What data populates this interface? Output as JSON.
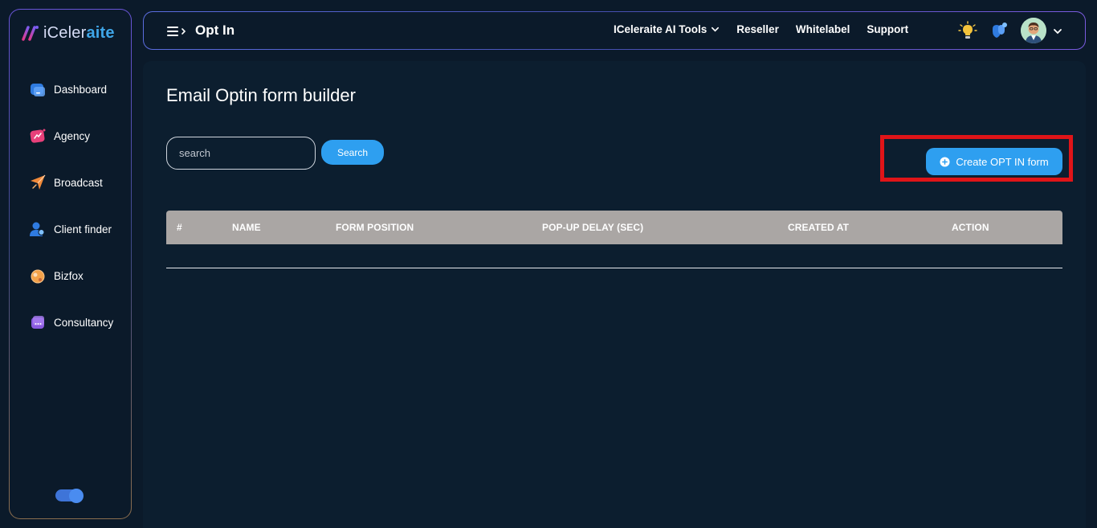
{
  "sidebar": {
    "logo": {
      "part1": "iCeler",
      "part2": "aite"
    },
    "items": [
      {
        "label": "Dashboard",
        "icon": "dashboard-icon"
      },
      {
        "label": "Agency",
        "icon": "agency-icon"
      },
      {
        "label": "Broadcast",
        "icon": "broadcast-icon"
      },
      {
        "label": "Client finder",
        "icon": "client-finder-icon"
      },
      {
        "label": "Bizfox",
        "icon": "bizfox-icon"
      },
      {
        "label": "Consultancy",
        "icon": "consultancy-icon"
      }
    ],
    "theme_toggle_on": true
  },
  "header": {
    "title": "Opt In",
    "links": [
      {
        "label": "ICeleraite AI Tools",
        "has_dropdown": true
      },
      {
        "label": "Reseller"
      },
      {
        "label": "Whitelabel"
      },
      {
        "label": "Support"
      }
    ],
    "icons": [
      "lightbulb-icon",
      "notifications-icon",
      "avatar",
      "chevron-down-icon"
    ]
  },
  "main": {
    "heading": "Email Optin form builder",
    "search": {
      "placeholder": "search",
      "value": "",
      "button_label": "Search"
    },
    "create_button_label": "Create OPT IN form",
    "table": {
      "columns": [
        "#",
        "NAME",
        "FORM POSITION",
        "POP-UP DELAY (SEC)",
        "CREATED AT",
        "ACTION"
      ],
      "rows": []
    }
  },
  "colors": {
    "background": "#0b1a2a",
    "accent": "#2e9ff0",
    "table_header": "#aaa6a4",
    "highlight": "#e01418"
  }
}
